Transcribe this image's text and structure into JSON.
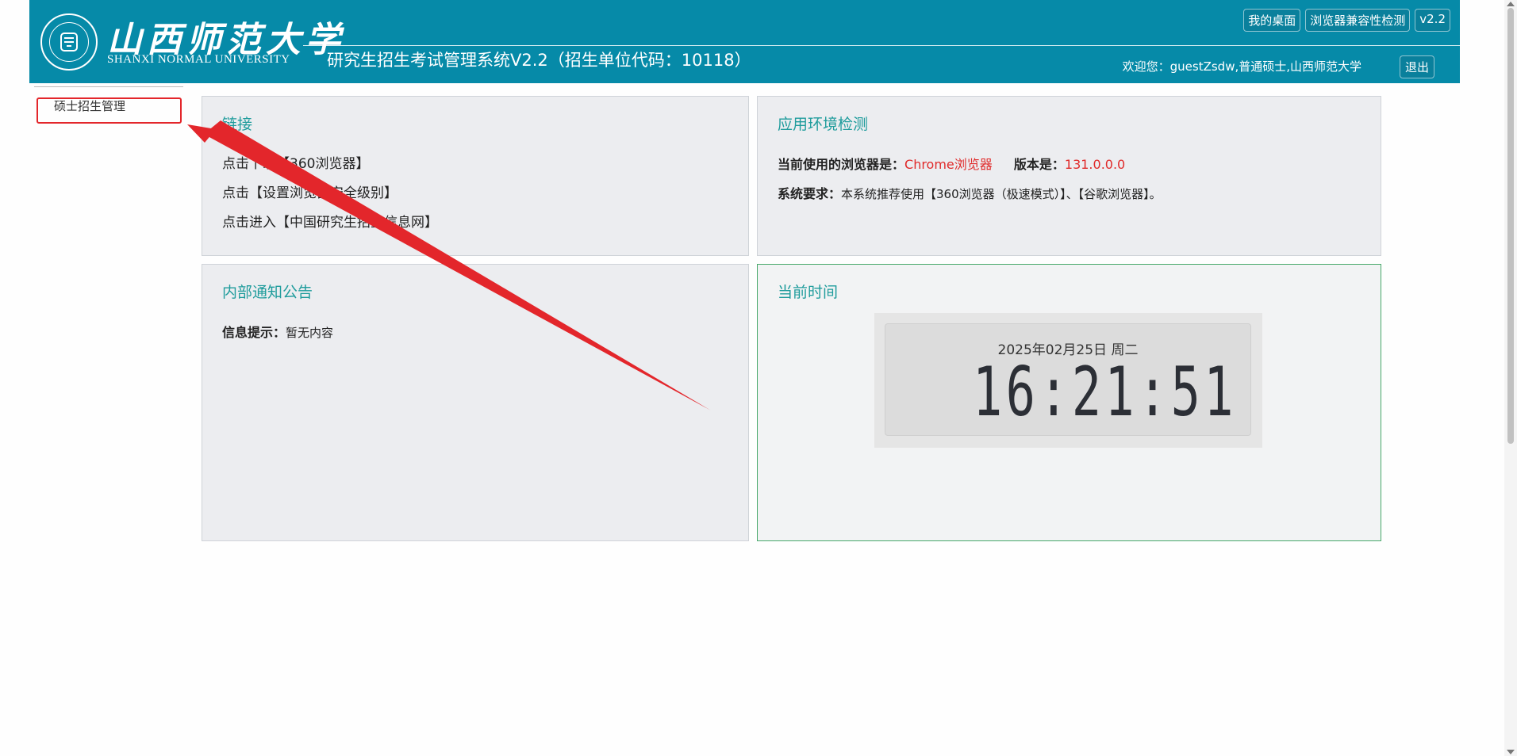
{
  "header": {
    "logo_cn": "山西师范大学",
    "logo_en": "SHANXI NORMAL UNIVERSITY",
    "system_title": "研究生招生考试管理系统V2.2（招生单位代码：10118）",
    "buttons": [
      "我的桌面",
      "浏览器兼容性检测",
      "v2.2"
    ],
    "welcome": "欢迎您：guestZsdw,普通硕士,山西师范大学",
    "logout": "退出"
  },
  "sidebar": {
    "items": [
      {
        "label": "硕士招生管理"
      }
    ]
  },
  "links_panel": {
    "title": "链接",
    "links": [
      "点击下载【360浏览器】",
      "点击【设置浏览器安全级别】",
      "点击进入【中国研究生招生信息网】"
    ]
  },
  "env_panel": {
    "title": "应用环境检测",
    "browser_label": "当前使用的浏览器是：",
    "browser_value": "Chrome浏览器",
    "version_label": "版本是：",
    "version_value": "131.0.0.0",
    "req_label": "系统要求：",
    "req_value": "本系统推荐使用【360浏览器（极速模式）】、【谷歌浏览器】。"
  },
  "notice_panel": {
    "title": "内部通知公告",
    "info_label": "信息提示：",
    "info_value": "暂无内容"
  },
  "time_panel": {
    "title": "当前时间",
    "date": "2025年02月25日 周二",
    "time": "16:21:51"
  },
  "colors": {
    "header_bg": "#068aa8",
    "panel_title": "#1f9c9c",
    "highlight_red": "#e3262b",
    "value_red": "#e02a2a",
    "clock_panel_border": "#47a86a"
  },
  "icons": [
    "university-seal-icon",
    "annotation-arrow-icon"
  ]
}
